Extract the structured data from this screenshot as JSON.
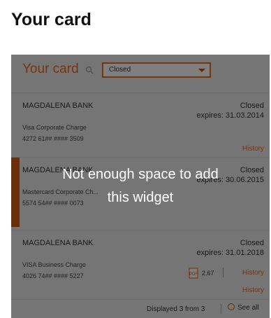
{
  "page": {
    "title": "Your card"
  },
  "widget": {
    "title": "Your card",
    "filter": {
      "value": "Closed"
    },
    "cards": [
      {
        "bank": "MAGDALENA BANK",
        "status": "Closed",
        "expires": "expires: 31.03.2014",
        "type": "Visa Corporate Charge",
        "number": "4272 61## #### 3509",
        "history": "History"
      },
      {
        "bank": "MAGDALENA BANK",
        "status": "Closed",
        "expires": "expires: 30.06.2015",
        "type": "Mastercard Corporate Ch...",
        "number": "5574 54## #### 0073",
        "pdf_label": "2.67",
        "history": "History"
      },
      {
        "bank": "MAGDALENA BANK",
        "status": "Closed",
        "expires": "expires: 31.01.2018",
        "type": "VISA Business Charge",
        "number": "4026 74## #### 5227",
        "history": "History"
      }
    ],
    "footer": {
      "count": "Displayed 3 from 3",
      "see_all": "See all"
    },
    "overlay": {
      "message_line1": "Not enough space to add",
      "message_line2": "this widget"
    }
  }
}
